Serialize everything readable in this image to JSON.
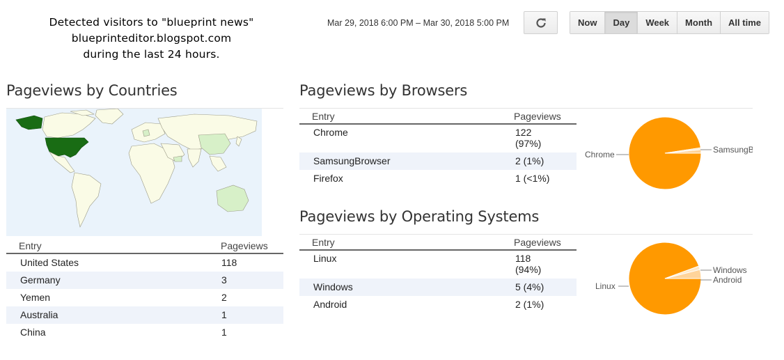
{
  "header": {
    "caption_line1": "Detected visitors to \"blueprint news\"",
    "caption_line2": "blueprinteditor.blogspot.com",
    "caption_line3": "during the last 24 hours.",
    "date_range": "Mar 29, 2018 6:00 PM – Mar 30, 2018 5:00 PM",
    "refresh_icon": "refresh-icon",
    "periods": [
      "Now",
      "Day",
      "Week",
      "Month",
      "All time"
    ],
    "active_period": "Day"
  },
  "countries": {
    "title": "Pageviews by Countries",
    "col_entry": "Entry",
    "col_pageviews": "Pageviews",
    "rows": [
      {
        "entry": "United States",
        "pageviews": "118"
      },
      {
        "entry": "Germany",
        "pageviews": "3"
      },
      {
        "entry": "Yemen",
        "pageviews": "2"
      },
      {
        "entry": "Australia",
        "pageviews": "1"
      },
      {
        "entry": "China",
        "pageviews": "1"
      }
    ],
    "colors": {
      "ocean": "#eaf3fb",
      "land": "#fafbe6",
      "strong": "#196c14",
      "light": "#d7f0c8"
    }
  },
  "browsers": {
    "title": "Pageviews by Browsers",
    "col_entry": "Entry",
    "col_pageviews": "Pageviews",
    "rows": [
      {
        "entry": "Chrome",
        "pv_line1": "122",
        "pv_line2": "(97%)"
      },
      {
        "entry": "SamsungBrowser",
        "pv_line1": "2 (1%)",
        "pv_line2": ""
      },
      {
        "entry": "Firefox",
        "pv_line1": "1 (<1%)",
        "pv_line2": ""
      }
    ],
    "pie_labels": {
      "left": "Chrome",
      "right": "SamsungB"
    },
    "pie_values": [
      122,
      2,
      1
    ]
  },
  "os": {
    "title": "Pageviews by Operating Systems",
    "col_entry": "Entry",
    "col_pageviews": "Pageviews",
    "rows": [
      {
        "entry": "Linux",
        "pv_line1": "118",
        "pv_line2": "(94%)"
      },
      {
        "entry": "Windows",
        "pv_line1": "5 (4%)",
        "pv_line2": ""
      },
      {
        "entry": "Android",
        "pv_line1": "2 (1%)",
        "pv_line2": ""
      }
    ],
    "pie_labels": {
      "left": "Linux",
      "right1": "Windows",
      "right2": "Android"
    },
    "pie_values": [
      118,
      5,
      2
    ]
  },
  "colors": {
    "pie_main": "#ff9900",
    "pie_slice2": "#ffd49a",
    "pie_slice3": "#ffe9c8",
    "pie_label": "#555555"
  }
}
